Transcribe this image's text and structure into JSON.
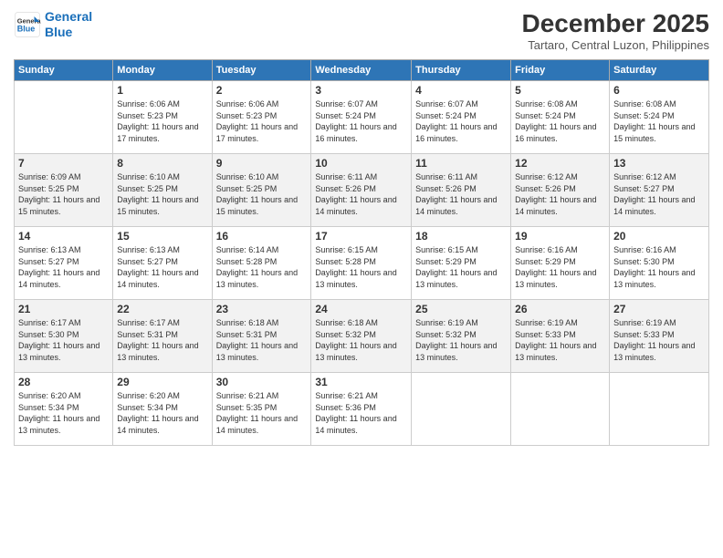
{
  "header": {
    "logo_line1": "General",
    "logo_line2": "Blue",
    "month": "December 2025",
    "location": "Tartaro, Central Luzon, Philippines"
  },
  "weekdays": [
    "Sunday",
    "Monday",
    "Tuesday",
    "Wednesday",
    "Thursday",
    "Friday",
    "Saturday"
  ],
  "weeks": [
    [
      {
        "day": "",
        "sunrise": "",
        "sunset": "",
        "daylight": ""
      },
      {
        "day": "1",
        "sunrise": "Sunrise: 6:06 AM",
        "sunset": "Sunset: 5:23 PM",
        "daylight": "Daylight: 11 hours and 17 minutes."
      },
      {
        "day": "2",
        "sunrise": "Sunrise: 6:06 AM",
        "sunset": "Sunset: 5:23 PM",
        "daylight": "Daylight: 11 hours and 17 minutes."
      },
      {
        "day": "3",
        "sunrise": "Sunrise: 6:07 AM",
        "sunset": "Sunset: 5:24 PM",
        "daylight": "Daylight: 11 hours and 16 minutes."
      },
      {
        "day": "4",
        "sunrise": "Sunrise: 6:07 AM",
        "sunset": "Sunset: 5:24 PM",
        "daylight": "Daylight: 11 hours and 16 minutes."
      },
      {
        "day": "5",
        "sunrise": "Sunrise: 6:08 AM",
        "sunset": "Sunset: 5:24 PM",
        "daylight": "Daylight: 11 hours and 16 minutes."
      },
      {
        "day": "6",
        "sunrise": "Sunrise: 6:08 AM",
        "sunset": "Sunset: 5:24 PM",
        "daylight": "Daylight: 11 hours and 15 minutes."
      }
    ],
    [
      {
        "day": "7",
        "sunrise": "Sunrise: 6:09 AM",
        "sunset": "Sunset: 5:25 PM",
        "daylight": "Daylight: 11 hours and 15 minutes."
      },
      {
        "day": "8",
        "sunrise": "Sunrise: 6:10 AM",
        "sunset": "Sunset: 5:25 PM",
        "daylight": "Daylight: 11 hours and 15 minutes."
      },
      {
        "day": "9",
        "sunrise": "Sunrise: 6:10 AM",
        "sunset": "Sunset: 5:25 PM",
        "daylight": "Daylight: 11 hours and 15 minutes."
      },
      {
        "day": "10",
        "sunrise": "Sunrise: 6:11 AM",
        "sunset": "Sunset: 5:26 PM",
        "daylight": "Daylight: 11 hours and 14 minutes."
      },
      {
        "day": "11",
        "sunrise": "Sunrise: 6:11 AM",
        "sunset": "Sunset: 5:26 PM",
        "daylight": "Daylight: 11 hours and 14 minutes."
      },
      {
        "day": "12",
        "sunrise": "Sunrise: 6:12 AM",
        "sunset": "Sunset: 5:26 PM",
        "daylight": "Daylight: 11 hours and 14 minutes."
      },
      {
        "day": "13",
        "sunrise": "Sunrise: 6:12 AM",
        "sunset": "Sunset: 5:27 PM",
        "daylight": "Daylight: 11 hours and 14 minutes."
      }
    ],
    [
      {
        "day": "14",
        "sunrise": "Sunrise: 6:13 AM",
        "sunset": "Sunset: 5:27 PM",
        "daylight": "Daylight: 11 hours and 14 minutes."
      },
      {
        "day": "15",
        "sunrise": "Sunrise: 6:13 AM",
        "sunset": "Sunset: 5:27 PM",
        "daylight": "Daylight: 11 hours and 14 minutes."
      },
      {
        "day": "16",
        "sunrise": "Sunrise: 6:14 AM",
        "sunset": "Sunset: 5:28 PM",
        "daylight": "Daylight: 11 hours and 13 minutes."
      },
      {
        "day": "17",
        "sunrise": "Sunrise: 6:15 AM",
        "sunset": "Sunset: 5:28 PM",
        "daylight": "Daylight: 11 hours and 13 minutes."
      },
      {
        "day": "18",
        "sunrise": "Sunrise: 6:15 AM",
        "sunset": "Sunset: 5:29 PM",
        "daylight": "Daylight: 11 hours and 13 minutes."
      },
      {
        "day": "19",
        "sunrise": "Sunrise: 6:16 AM",
        "sunset": "Sunset: 5:29 PM",
        "daylight": "Daylight: 11 hours and 13 minutes."
      },
      {
        "day": "20",
        "sunrise": "Sunrise: 6:16 AM",
        "sunset": "Sunset: 5:30 PM",
        "daylight": "Daylight: 11 hours and 13 minutes."
      }
    ],
    [
      {
        "day": "21",
        "sunrise": "Sunrise: 6:17 AM",
        "sunset": "Sunset: 5:30 PM",
        "daylight": "Daylight: 11 hours and 13 minutes."
      },
      {
        "day": "22",
        "sunrise": "Sunrise: 6:17 AM",
        "sunset": "Sunset: 5:31 PM",
        "daylight": "Daylight: 11 hours and 13 minutes."
      },
      {
        "day": "23",
        "sunrise": "Sunrise: 6:18 AM",
        "sunset": "Sunset: 5:31 PM",
        "daylight": "Daylight: 11 hours and 13 minutes."
      },
      {
        "day": "24",
        "sunrise": "Sunrise: 6:18 AM",
        "sunset": "Sunset: 5:32 PM",
        "daylight": "Daylight: 11 hours and 13 minutes."
      },
      {
        "day": "25",
        "sunrise": "Sunrise: 6:19 AM",
        "sunset": "Sunset: 5:32 PM",
        "daylight": "Daylight: 11 hours and 13 minutes."
      },
      {
        "day": "26",
        "sunrise": "Sunrise: 6:19 AM",
        "sunset": "Sunset: 5:33 PM",
        "daylight": "Daylight: 11 hours and 13 minutes."
      },
      {
        "day": "27",
        "sunrise": "Sunrise: 6:19 AM",
        "sunset": "Sunset: 5:33 PM",
        "daylight": "Daylight: 11 hours and 13 minutes."
      }
    ],
    [
      {
        "day": "28",
        "sunrise": "Sunrise: 6:20 AM",
        "sunset": "Sunset: 5:34 PM",
        "daylight": "Daylight: 11 hours and 13 minutes."
      },
      {
        "day": "29",
        "sunrise": "Sunrise: 6:20 AM",
        "sunset": "Sunset: 5:34 PM",
        "daylight": "Daylight: 11 hours and 14 minutes."
      },
      {
        "day": "30",
        "sunrise": "Sunrise: 6:21 AM",
        "sunset": "Sunset: 5:35 PM",
        "daylight": "Daylight: 11 hours and 14 minutes."
      },
      {
        "day": "31",
        "sunrise": "Sunrise: 6:21 AM",
        "sunset": "Sunset: 5:36 PM",
        "daylight": "Daylight: 11 hours and 14 minutes."
      },
      {
        "day": "",
        "sunrise": "",
        "sunset": "",
        "daylight": ""
      },
      {
        "day": "",
        "sunrise": "",
        "sunset": "",
        "daylight": ""
      },
      {
        "day": "",
        "sunrise": "",
        "sunset": "",
        "daylight": ""
      }
    ]
  ]
}
